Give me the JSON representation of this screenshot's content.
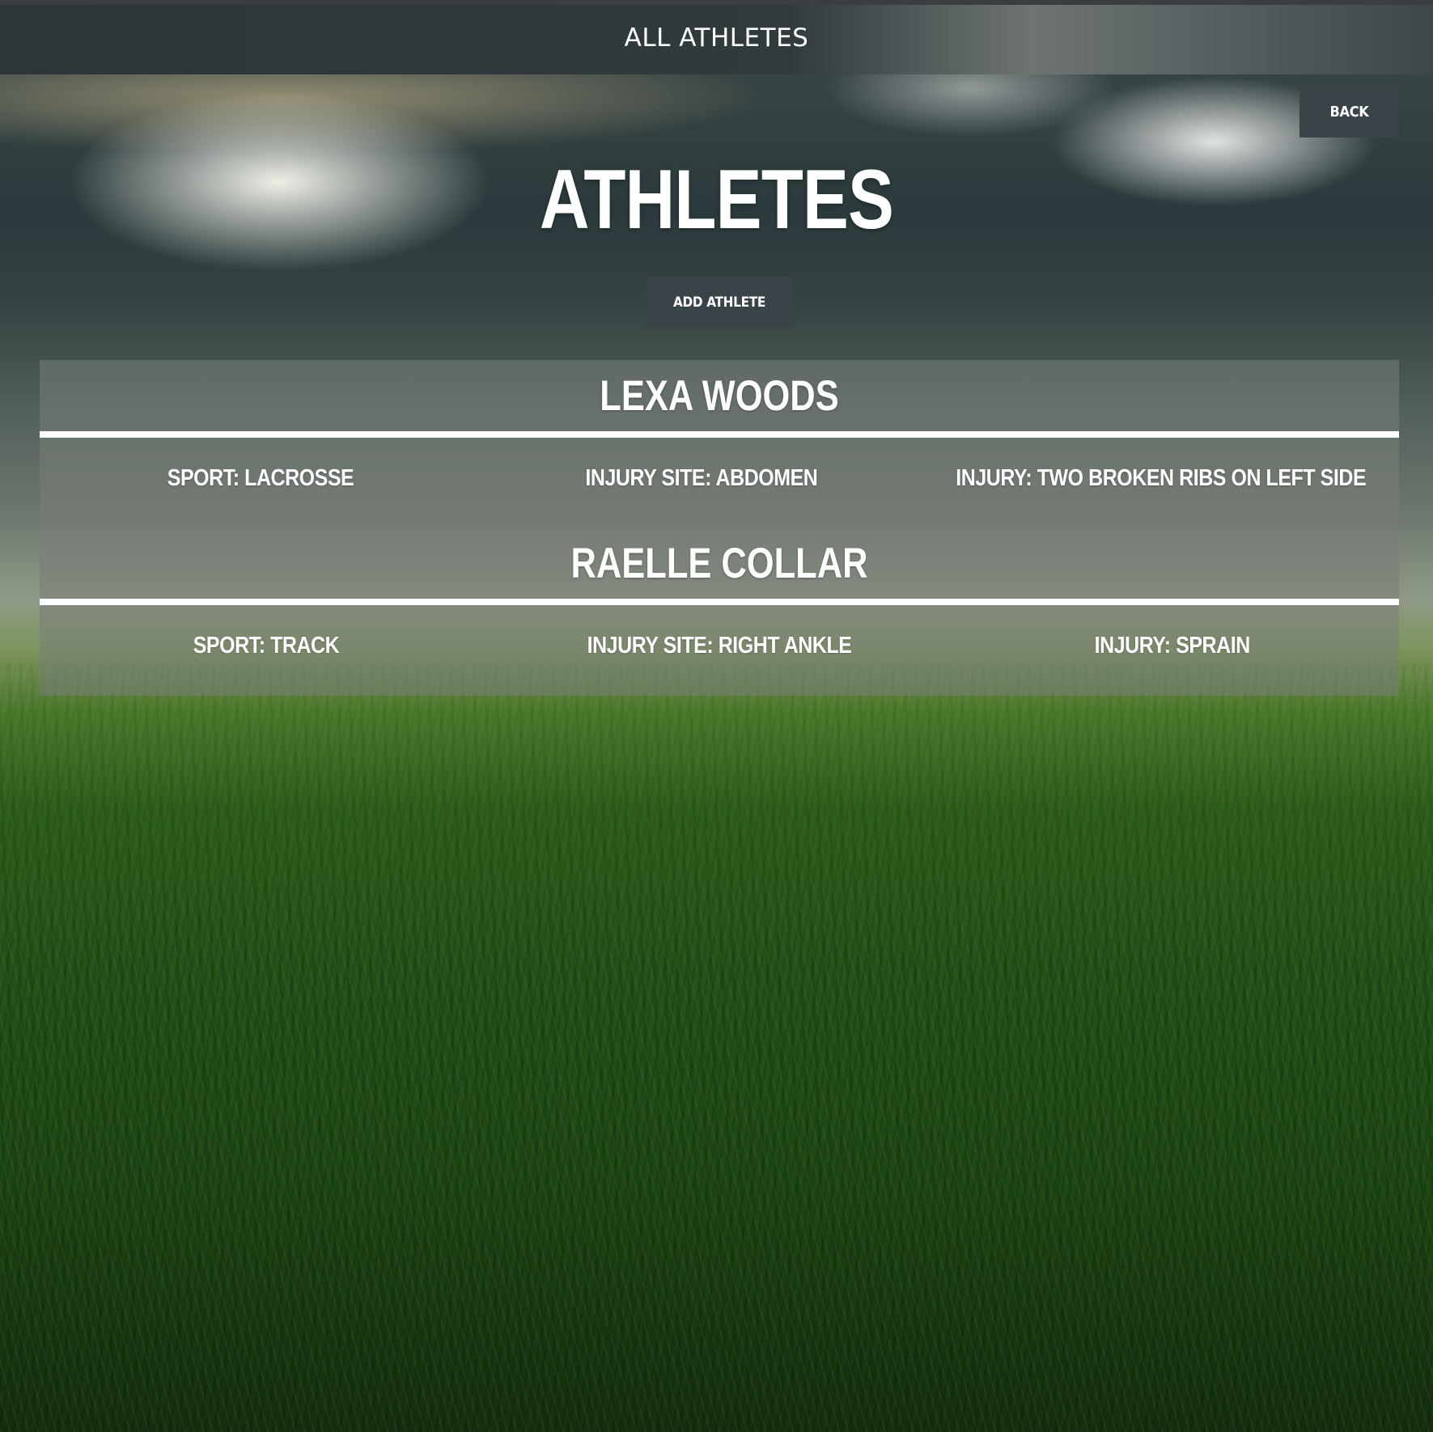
{
  "header": {
    "title": "ALL ATHLETES"
  },
  "back_button": {
    "label": "BACK"
  },
  "page_title": "ATHLETES",
  "add_button": {
    "label": "ADD ATHLETE"
  },
  "athletes": [
    {
      "name": "LEXA WOODS",
      "sport": "SPORT: LACROSSE",
      "injury_site": "INJURY SITE: ABDOMEN",
      "injury": "INJURY: TWO BROKEN RIBS ON LEFT SIDE"
    },
    {
      "name": "RAELLE COLLAR",
      "sport": "SPORT: TRACK",
      "injury_site": "INJURY SITE: RIGHT ANKLE",
      "injury": "INJURY: SPRAIN"
    }
  ],
  "colors": {
    "button_bg": "#3a4448",
    "text": "#ffffff",
    "panel_bg": "rgba(120,125,120,0.55)"
  }
}
